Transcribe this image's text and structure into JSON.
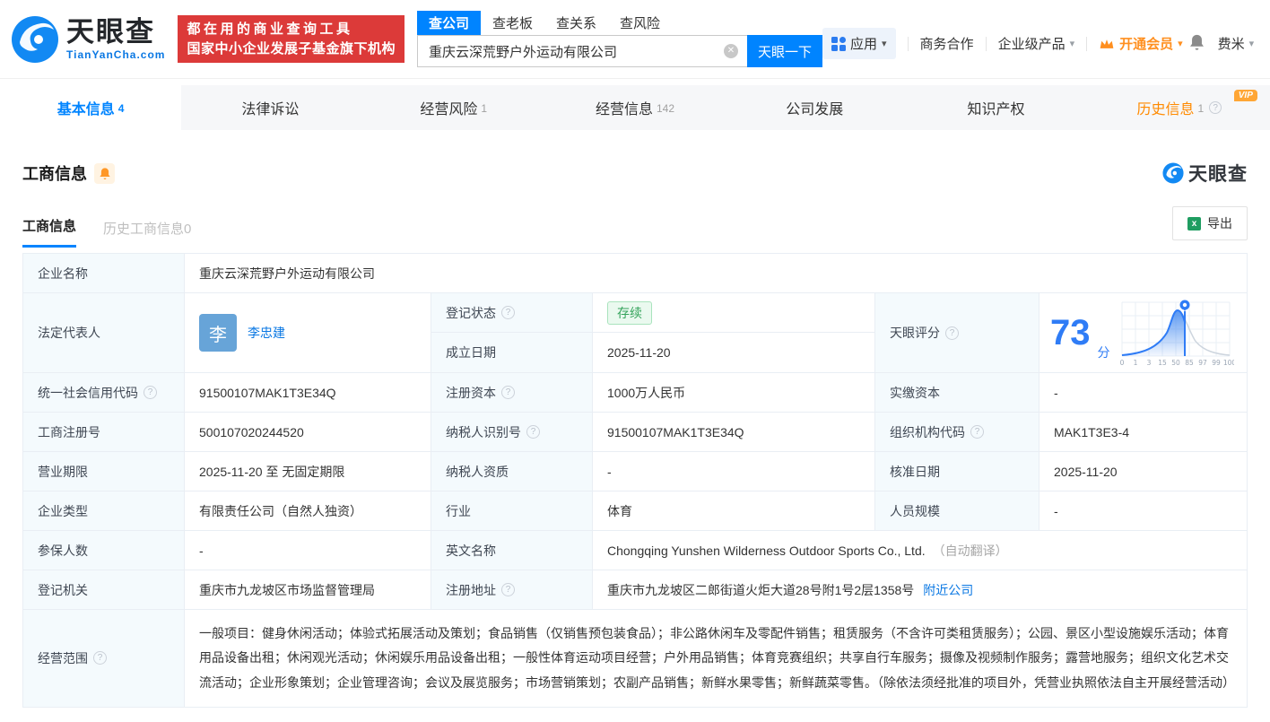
{
  "colors": {
    "accent": "#0084ff",
    "banner_red": "#dc3a39",
    "vip_orange": "#ff8f1f",
    "status_green": "#36a45c",
    "score_blue": "#2f7cf6",
    "label_bg": "#f4fafd"
  },
  "icons": {
    "question": "?",
    "clear": "✕",
    "caret": "▾"
  },
  "brand": {
    "name": "天眼查",
    "domain": "TianYanCha.com",
    "slogan1": "都在用的商业查询工具",
    "slogan2": "国家中小企业发展子基金旗下机构"
  },
  "search": {
    "tabs": [
      {
        "label": "查公司"
      },
      {
        "label": "查老板"
      },
      {
        "label": "查关系"
      },
      {
        "label": "查风险"
      }
    ],
    "value": "重庆云深荒野户外运动有限公司",
    "button": "天眼一下"
  },
  "topnav": {
    "apps": "应用",
    "cooperation": "商务合作",
    "enterprise": "企业级产品",
    "vip": "开通会员",
    "username": "费米"
  },
  "main_tabs": [
    {
      "label": "基本信息",
      "count": "4"
    },
    {
      "label": "法律诉讼",
      "count": ""
    },
    {
      "label": "经营风险",
      "count": "1"
    },
    {
      "label": "经营信息",
      "count": "142"
    },
    {
      "label": "公司发展",
      "count": ""
    },
    {
      "label": "知识产权",
      "count": ""
    },
    {
      "label": "历史信息",
      "count": "1",
      "vip": "VIP"
    }
  ],
  "section": {
    "title": "工商信息",
    "watermark": "天眼查",
    "subtab_current": "工商信息",
    "subtab_history": "历史工商信息0",
    "export": "导出"
  },
  "score_chart": {
    "score": "73",
    "unit": "分",
    "ticks": [
      "0",
      "1",
      "3",
      "15",
      "50",
      "85",
      "97",
      "99",
      "100"
    ]
  },
  "fields": {
    "company_name": {
      "label": "企业名称",
      "value": "重庆云深荒野户外运动有限公司"
    },
    "legal_rep": {
      "label": "法定代表人",
      "avatar": "李",
      "name": "李忠建"
    },
    "reg_status": {
      "label": "登记状态",
      "value": "存续"
    },
    "est_date": {
      "label": "成立日期",
      "value": "2025-11-20"
    },
    "score": {
      "label": "天眼评分"
    },
    "uscc": {
      "label": "统一社会信用代码",
      "value": "91500107MAK1T3E34Q"
    },
    "reg_capital": {
      "label": "注册资本",
      "value": "1000万人民币"
    },
    "paid_capital": {
      "label": "实缴资本",
      "value": "-"
    },
    "reg_number": {
      "label": "工商注册号",
      "value": "500107020244520"
    },
    "taxpayer_id": {
      "label": "纳税人识别号",
      "value": "91500107MAK1T3E34Q"
    },
    "org_code": {
      "label": "组织机构代码",
      "value": "MAK1T3E3-4"
    },
    "biz_term": {
      "label": "营业期限",
      "value": "2025-11-20 至 无固定期限"
    },
    "taxpayer_qual": {
      "label": "纳税人资质",
      "value": "-"
    },
    "approval_date": {
      "label": "核准日期",
      "value": "2025-11-20"
    },
    "company_type": {
      "label": "企业类型",
      "value": "有限责任公司（自然人独资）"
    },
    "industry": {
      "label": "行业",
      "value": "体育"
    },
    "staff_size": {
      "label": "人员规模",
      "value": "-"
    },
    "insured_count": {
      "label": "参保人数",
      "value": "-"
    },
    "english_name": {
      "label": "英文名称",
      "value": "Chongqing Yunshen Wilderness Outdoor Sports Co., Ltd.",
      "note": "（自动翻译）"
    },
    "reg_authority": {
      "label": "登记机关",
      "value": "重庆市九龙坡区市场监督管理局"
    },
    "reg_address": {
      "label": "注册地址",
      "value": "重庆市九龙坡区二郎街道火炬大道28号附1号2层1358号",
      "link": "附近公司"
    },
    "business_scope": {
      "label": "经营范围",
      "value": "一般项目：健身休闲活动；体验式拓展活动及策划；食品销售（仅销售预包装食品）；非公路休闲车及零配件销售；租赁服务（不含许可类租赁服务）；公园、景区小型设施娱乐活动；体育用品设备出租；休闲观光活动；休闲娱乐用品设备出租；一般性体育运动项目经营；户外用品销售；体育竞赛组织；共享自行车服务；摄像及视频制作服务；露营地服务；组织文化艺术交流活动；企业形象策划；企业管理咨询；会议及展览服务；市场营销策划；农副产品销售；新鲜水果零售；新鲜蔬菜零售。（除依法须经批准的项目外，凭营业执照依法自主开展经营活动）"
    }
  }
}
